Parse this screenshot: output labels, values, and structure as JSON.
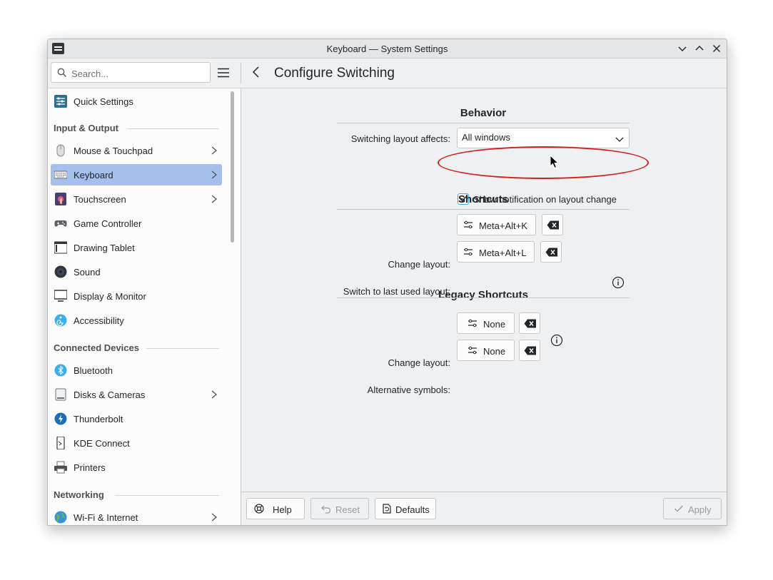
{
  "window": {
    "title": "Keyboard — System Settings"
  },
  "toolbar": {
    "search_placeholder": "Search...",
    "page_title": "Configure Switching"
  },
  "sidebar": {
    "items": [
      {
        "label": "Quick Settings",
        "icon": "sliders-icon",
        "chevron": false
      },
      {
        "label": "Mouse & Touchpad",
        "icon": "mouse-icon",
        "chevron": true
      },
      {
        "label": "Keyboard",
        "icon": "keyboard-icon",
        "chevron": true,
        "active": true
      },
      {
        "label": "Touchscreen",
        "icon": "touchscreen-icon",
        "chevron": true
      },
      {
        "label": "Game Controller",
        "icon": "gamepad-icon",
        "chevron": false
      },
      {
        "label": "Drawing Tablet",
        "icon": "tablet-icon",
        "chevron": false
      },
      {
        "label": "Sound",
        "icon": "speaker-icon",
        "chevron": false
      },
      {
        "label": "Display & Monitor",
        "icon": "monitor-icon",
        "chevron": false
      },
      {
        "label": "Accessibility",
        "icon": "accessibility-icon",
        "chevron": false
      },
      {
        "label": "Bluetooth",
        "icon": "bluetooth-icon",
        "chevron": false
      },
      {
        "label": "Disks & Cameras",
        "icon": "disk-icon",
        "chevron": true
      },
      {
        "label": "Thunderbolt",
        "icon": "thunderbolt-icon",
        "chevron": false
      },
      {
        "label": "KDE Connect",
        "icon": "phone-icon",
        "chevron": false
      },
      {
        "label": "Printers",
        "icon": "printer-icon",
        "chevron": false
      },
      {
        "label": "Wi-Fi & Internet",
        "icon": "globe-icon",
        "chevron": true
      }
    ],
    "sections": [
      "Input & Output",
      "Connected Devices",
      "Networking"
    ]
  },
  "behavior": {
    "heading": "Behavior",
    "switching_label": "Switching layout affects:",
    "switching_value": "All windows",
    "notification_label": "Show notification on layout change",
    "notification_checked": true
  },
  "shortcuts": {
    "heading": "Shortcuts",
    "change_label": "Change layout:",
    "change_value": "Meta+Alt+K",
    "last_label": "Switch to last used layout:",
    "last_value": "Meta+Alt+L"
  },
  "legacy": {
    "heading": "Legacy Shortcuts",
    "change_label": "Change layout:",
    "change_value": "None",
    "alt_label": "Alternative symbols:",
    "alt_value": "None"
  },
  "footer": {
    "help": "Help",
    "reset": "Reset",
    "defaults": "Defaults",
    "apply": "Apply"
  },
  "colors": {
    "accent": "#3daee9",
    "selection": "#a5c0ec",
    "annotation": "#d41f1f"
  }
}
